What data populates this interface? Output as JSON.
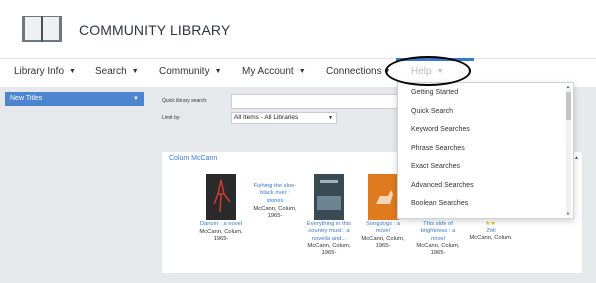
{
  "header": {
    "title": "COMMUNITY LIBRARY",
    "logo_icon": "open-book-icon"
  },
  "nav": {
    "items": [
      {
        "label": "Library Info"
      },
      {
        "label": "Search"
      },
      {
        "label": "Community"
      },
      {
        "label": "My Account"
      },
      {
        "label": "Connections"
      },
      {
        "label": "Help"
      }
    ]
  },
  "sidebar": {
    "select_label": "New Titles"
  },
  "search": {
    "quick_label": "Quick library search:",
    "input_value": "",
    "limit_label": "Limit by:",
    "limit_value": "All Items - All Libraries"
  },
  "panel": {
    "heading": "Colum McCann",
    "books": [
      {
        "title_lines": [
          "Dancer : a novel"
        ],
        "author_lines": [
          "McCann, Colum,",
          "1965-"
        ],
        "cover": "#2a2a2a"
      },
      {
        "title_lines": [
          "Fishing the sloe-",
          "black river :",
          "stories"
        ],
        "author_lines": [
          "McCann, Colum,",
          "1965-"
        ],
        "cover": ""
      },
      {
        "title_lines": [
          "Everything in this",
          "country must : a",
          "novella and..."
        ],
        "author_lines": [
          "McCann, Colum,",
          "1965-"
        ],
        "cover": "#3a4a55"
      },
      {
        "title_lines": [
          "Songdogs : a",
          "novel"
        ],
        "author_lines": [
          "McCann, Colum,",
          "1965-"
        ],
        "cover": "#e07a1e"
      },
      {
        "title_lines": [
          "This side of",
          "brightness : a",
          "novel"
        ],
        "author_lines": [
          "McCann, Colum,",
          "1965-"
        ],
        "cover": ""
      },
      {
        "title_lines": [
          "Zoli"
        ],
        "author_lines": [
          "McCann, Colum."
        ],
        "cover": "",
        "stars": "★★"
      }
    ]
  },
  "help_menu": {
    "items": [
      {
        "label": "Getting Started"
      },
      {
        "label": "Quick Search"
      },
      {
        "label": "Keyword Searches"
      },
      {
        "label": "Phrase Searches"
      },
      {
        "label": "Exact Searches"
      },
      {
        "label": "Advanced Searches"
      },
      {
        "label": "Boolean Searches"
      }
    ]
  },
  "colors": {
    "accent": "#4d86cf",
    "link": "#3b7ac8",
    "background": "#e6e9ec"
  }
}
